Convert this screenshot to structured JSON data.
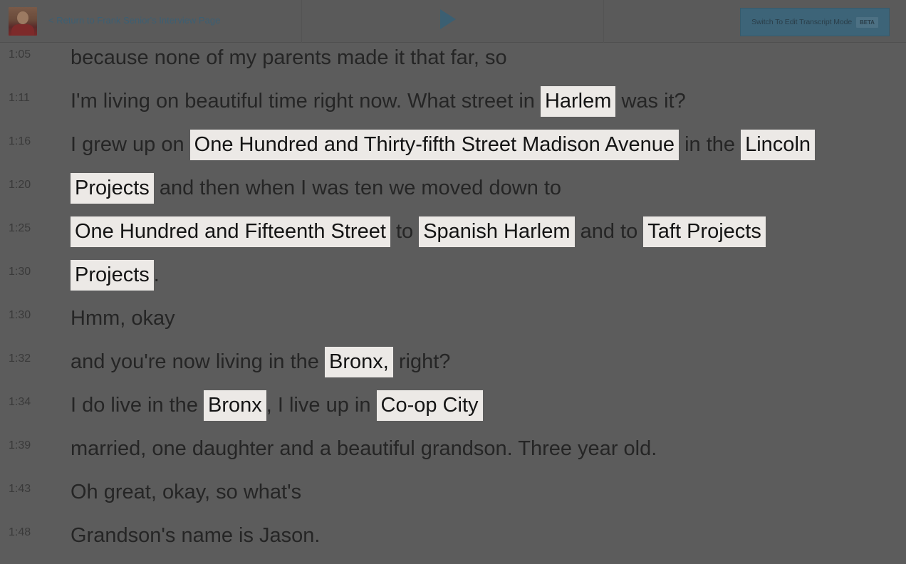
{
  "header": {
    "back_link": "< Return to Frank Senior's Interview Page",
    "mode_button_label": "Switch To Edit Transcript Mode",
    "mode_button_badge": "BETA",
    "play_icon": "play-icon",
    "avatar_icon": "interviewee-avatar"
  },
  "colors": {
    "accent": "#3d6478",
    "play": "#3b5f72",
    "highlight": "#ece9e6",
    "background": "#5c5c5c"
  },
  "transcript": [
    {
      "time": "1:05",
      "segments": [
        {
          "t": "because none of my parents made it that far, so",
          "h": false
        }
      ]
    },
    {
      "time": "1:11",
      "segments": [
        {
          "t": "I'm living on beautiful time right now. What street in ",
          "h": false
        },
        {
          "t": "Harlem",
          "h": true
        },
        {
          "t": " was it?",
          "h": false
        }
      ]
    },
    {
      "time": "1:16",
      "segments": [
        {
          "t": "I grew up on ",
          "h": false
        },
        {
          "t": "One Hundred and Thirty-fifth Street Madison Avenue",
          "h": true
        },
        {
          "t": " in the ",
          "h": false
        },
        {
          "t": "Lincoln",
          "h": true
        }
      ]
    },
    {
      "time": "1:20",
      "segments": [
        {
          "t": "Projects",
          "h": true
        },
        {
          "t": " and then when I was ten we moved down to",
          "h": false
        }
      ]
    },
    {
      "time": "1:25",
      "segments": [
        {
          "t": "One Hundred and Fifteenth Street",
          "h": true
        },
        {
          "t": " to ",
          "h": false
        },
        {
          "t": "Spanish Harlem",
          "h": true
        },
        {
          "t": " and to ",
          "h": false
        },
        {
          "t": "Taft Projects",
          "h": true
        }
      ]
    },
    {
      "time": "1:30",
      "segments": [
        {
          "t": "Projects",
          "h": true
        },
        {
          "t": ".",
          "h": false
        }
      ]
    },
    {
      "time": "1:30",
      "segments": [
        {
          "t": "Hmm, okay",
          "h": false
        }
      ]
    },
    {
      "time": "1:32",
      "segments": [
        {
          "t": "and you're now living in the ",
          "h": false
        },
        {
          "t": "Bronx,",
          "h": true
        },
        {
          "t": " right?",
          "h": false
        }
      ]
    },
    {
      "time": "1:34",
      "segments": [
        {
          "t": "I do live in the ",
          "h": false
        },
        {
          "t": "Bronx",
          "h": true
        },
        {
          "t": ", I live up in ",
          "h": false
        },
        {
          "t": "Co-op City",
          "h": true
        }
      ]
    },
    {
      "time": "1:39",
      "segments": [
        {
          "t": "married, one daughter and a beautiful grandson. Three year old.",
          "h": false
        }
      ]
    },
    {
      "time": "1:43",
      "segments": [
        {
          "t": "Oh great, okay, so what's",
          "h": false
        }
      ]
    },
    {
      "time": "1:48",
      "segments": [
        {
          "t": "Grandson's name is Jason.",
          "h": false
        }
      ]
    }
  ]
}
